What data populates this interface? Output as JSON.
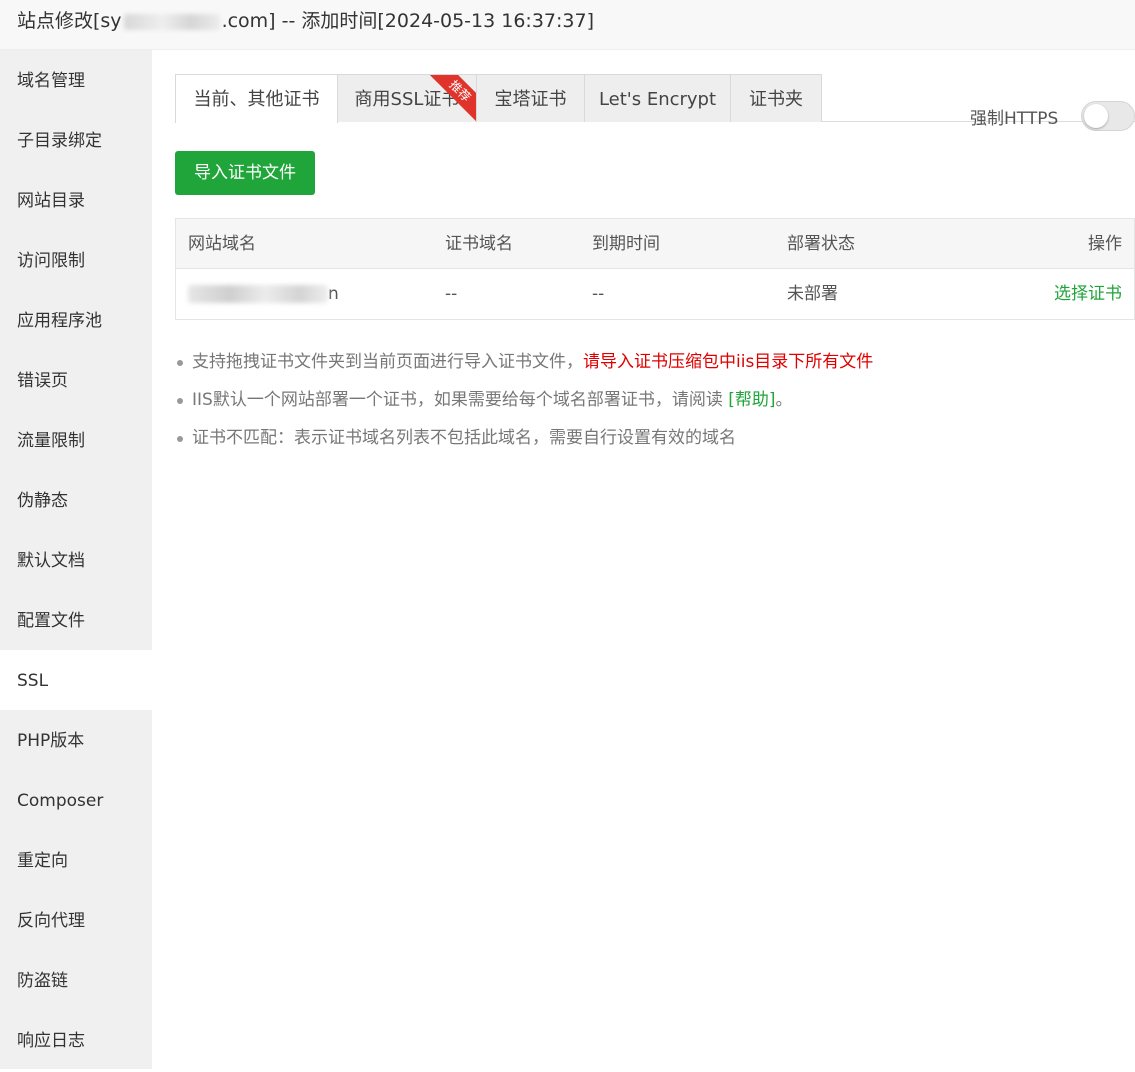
{
  "window": {
    "title_prefix": "站点修改[sy",
    "title_suffix": ".com] -- 添加时间[2024-05-13 16:37:37]"
  },
  "sidebar": {
    "items": [
      {
        "label": "域名管理"
      },
      {
        "label": "子目录绑定"
      },
      {
        "label": "网站目录"
      },
      {
        "label": "访问限制"
      },
      {
        "label": "应用程序池"
      },
      {
        "label": "错误页"
      },
      {
        "label": "流量限制"
      },
      {
        "label": "伪静态"
      },
      {
        "label": "默认文档"
      },
      {
        "label": "配置文件"
      },
      {
        "label": "SSL",
        "active": true
      },
      {
        "label": "PHP版本"
      },
      {
        "label": "Composer"
      },
      {
        "label": "重定向"
      },
      {
        "label": "反向代理"
      },
      {
        "label": "防盗链"
      },
      {
        "label": "响应日志"
      }
    ]
  },
  "tabs": {
    "items": [
      {
        "label": "当前、其他证书",
        "active": true
      },
      {
        "label": "商用SSL证书",
        "badge": "推荐"
      },
      {
        "label": "宝塔证书"
      },
      {
        "label": "Let's Encrypt"
      },
      {
        "label": "证书夹"
      }
    ]
  },
  "https": {
    "label": "强制HTTPS",
    "enabled": false
  },
  "actions": {
    "import_label": "导入证书文件"
  },
  "table": {
    "headers": [
      "网站域名",
      "证书域名",
      "到期时间",
      "部署状态",
      "操作"
    ],
    "rows": [
      {
        "site_tail": "n",
        "cert_domain": "--",
        "expire": "--",
        "status": "未部署",
        "action": "选择证书"
      }
    ]
  },
  "notes": {
    "n1_text": "支持拖拽证书文件夹到当前页面进行导入证书文件，",
    "n1_red": "请导入证书压缩包中iis目录下所有文件",
    "n2_text": "IIS默认一个网站部署一个证书，如果需要给每个域名部署证书，请阅读 ",
    "n2_link": "[帮助]",
    "n2_end": "。",
    "n3_text": "证书不匹配：表示证书域名列表不包括此域名，需要自行设置有效的域名"
  },
  "colors": {
    "accent_green": "#20a53a",
    "warning_red": "#e00000",
    "ribbon_red": "#e0332b"
  }
}
